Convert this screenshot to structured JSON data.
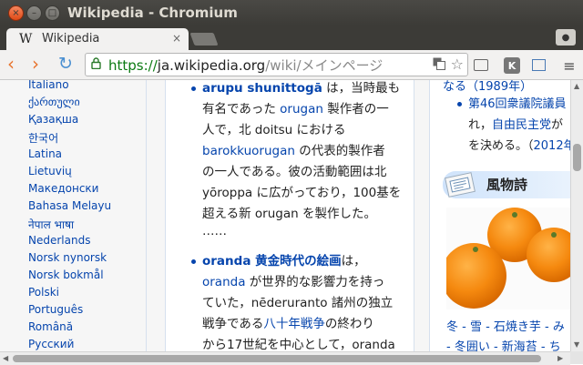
{
  "window": {
    "title": "Wikipedia - Chromium",
    "close": "×",
    "minimize": "–",
    "maximize": "□"
  },
  "tab": {
    "favicon": "W",
    "label": "Wikipedia",
    "close": "×"
  },
  "toolbar": {
    "back": "‹",
    "forward": "›",
    "reload": "↻",
    "url_scheme": "https://",
    "url_host": "ja.wikipedia.org",
    "url_path": "/wiki/メインページ",
    "star": "☆",
    "ext_k": "K",
    "menu": "≡",
    "profile": "●"
  },
  "languages": [
    "Italiano",
    "ქართული",
    "Қазақша",
    "한국어",
    "Latina",
    "Lietuvių",
    "Македонски",
    "Bahasa Melayu",
    "नेपाल भाषा",
    "Nederlands",
    "Norsk nynorsk",
    "Norsk bokmål",
    "Polski",
    "Português",
    "Română",
    "Русский"
  ],
  "main": {
    "item1_title": "arupu shunittogā",
    "item1_l1_rest": " は，当時最も",
    "item1_l2_a": "有名であった ",
    "item1_l2_link": "orugan",
    "item1_l2_b": " 製作者の一",
    "item1_l3": "人で，北 doitsu における",
    "item1_l4_link": "barokkuorugan",
    "item1_l4_b": " の代表的製作者",
    "item1_l5": "の一人である。彼の活動範囲は北",
    "item1_l6": "yōroppa に広がっており，100基を",
    "item1_l7": "超える新 orugan を製作した。",
    "item1_l8": "……",
    "item2_title": "oranda 黄金時代の絵画",
    "item2_l1_rest": "は，",
    "item2_l2_link": "oranda",
    "item2_l2_b": " が世界的な影響力を持っ",
    "item2_l3": "ていた，nēderuranto 諸州の独立",
    "item2_l4_a": "戦争である",
    "item2_l4_link": "八十年戦争",
    "item2_l4_b": "の終わり",
    "item2_l5": "から17世紀を中心として，oranda"
  },
  "right": {
    "top_line": "なる（1989年）",
    "b1_l1": "第46回衆議院議員",
    "b1_l2_a": "れ，",
    "b1_l2_link": "自由民主党",
    "b1_l2_b": "が",
    "b1_l3_a": "を決める。（",
    "b1_l3_link": "2012年",
    "heading": "風物詩",
    "foot1": "冬 - 雪 - 石焼き芋 - み",
    "foot2": "- 冬囲い - 新海苔 - ち"
  },
  "colors": {
    "link": "#0645ad",
    "scheme_green": "#0b7a12",
    "titlebar": "#3c3b37"
  }
}
